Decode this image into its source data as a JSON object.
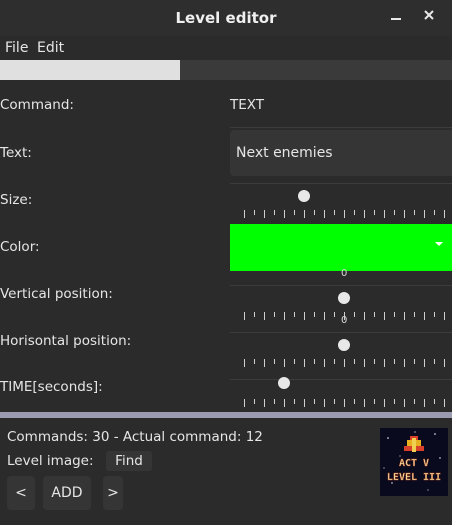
{
  "window": {
    "title": "Level editor",
    "minimize_glyph": "✕",
    "close_glyph": "✕"
  },
  "menu": {
    "items": [
      "File",
      "Edit"
    ]
  },
  "editor": {
    "command_label": "Command:",
    "command_value": "TEXT",
    "text_label": "Text:",
    "text_value": "Next enemies",
    "size_label": "Size:",
    "size_value_fraction": 0.3,
    "color_label": "Color:",
    "color_value": "#00ff00",
    "color_dropdown_icon": "chevron-down-icon",
    "vertical_label": "Vertical position:",
    "vertical_value_fraction": 0.5,
    "vertical_tick_zero": "0",
    "horizontal_label": "Horisontal position:",
    "horizontal_value_fraction": 0.5,
    "horizontal_tick_zero": "0",
    "time_label": "TIME[seconds]:",
    "time_value_fraction": 0.2
  },
  "bottom": {
    "commands_text": "Commands: 30 - Actual command: 12",
    "level_image_label": "Level image:",
    "find_label": "Find",
    "prev_label": "<",
    "add_label": "ADD",
    "next_label": ">",
    "preview_line1": "ACT V",
    "preview_line2": "LEVEL III"
  }
}
